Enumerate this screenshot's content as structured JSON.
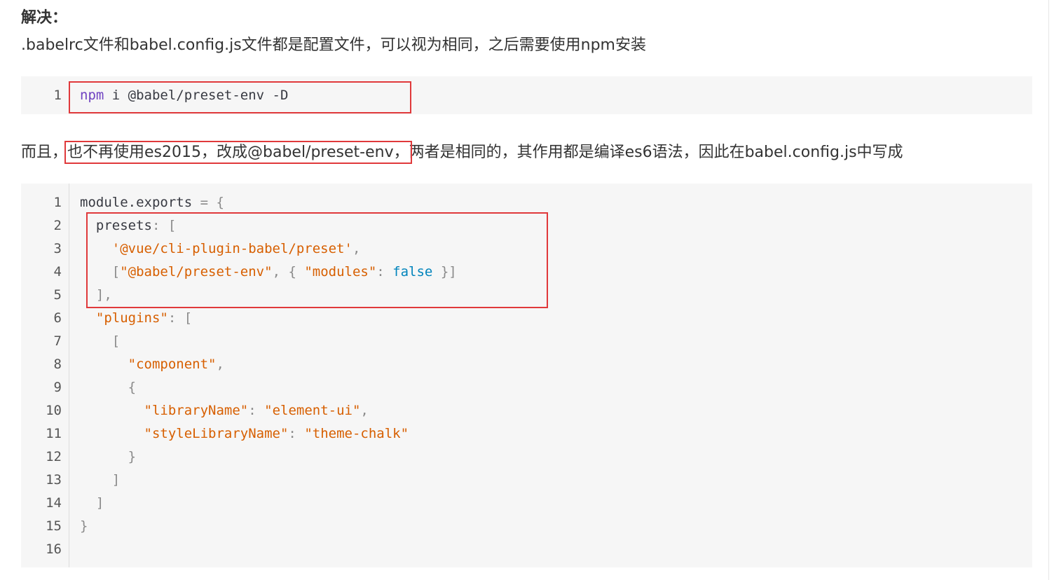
{
  "heading": {
    "text": "解决："
  },
  "paragraph1": {
    "text": ".babelrc文件和babel.config.js文件都是配置文件，可以视为相同，之后需要使用npm安装"
  },
  "code_block_1": {
    "line_numbers": [
      "1"
    ],
    "line1": {
      "cmd": "npm",
      "rest": " i @babel/preset-env -D"
    }
  },
  "paragraph2": {
    "before": "而且，",
    "highlight": "也不再使用es2015，改成@babel/preset-env，",
    "after": "两者是相同的，其作用都是编译es6语法，因此在babel.config.js中写成"
  },
  "code_block_2": {
    "line_numbers": [
      "1",
      "2",
      "3",
      "4",
      "5",
      "6",
      "7",
      "8",
      "9",
      "10",
      "11",
      "12",
      "13",
      "14",
      "15",
      "16"
    ],
    "tokens": {
      "module_exports": "module.exports",
      "eq": " = ",
      "brace_open": "{",
      "brace_close": "}",
      "presets": "presets",
      "colon": ": ",
      "bracket_open": "[",
      "bracket_close": "]",
      "bracket_close_comma": "],",
      "comma": ",",
      "str_cli_preset": "'@vue/cli-plugin-babel/preset'",
      "str_preset_env": "\"@babel/preset-env\"",
      "str_modules": "\"modules\"",
      "kw_false": "false",
      "obj_close_arr_close": " }]",
      "comma_space_brace": ", { ",
      "str_plugins": "\"plugins\"",
      "str_component": "\"component\"",
      "str_libraryName": "\"libraryName\"",
      "str_element_ui": "\"element-ui\"",
      "str_styleLibraryName": "\"styleLibraryName\"",
      "str_theme_chalk": "\"theme-chalk\""
    }
  },
  "colors": {
    "highlight_border": "#e0393b",
    "code_background": "#f6f6f6",
    "string": "#d75f00",
    "keyword": "#6f42c1",
    "boolean": "#0184bc"
  }
}
